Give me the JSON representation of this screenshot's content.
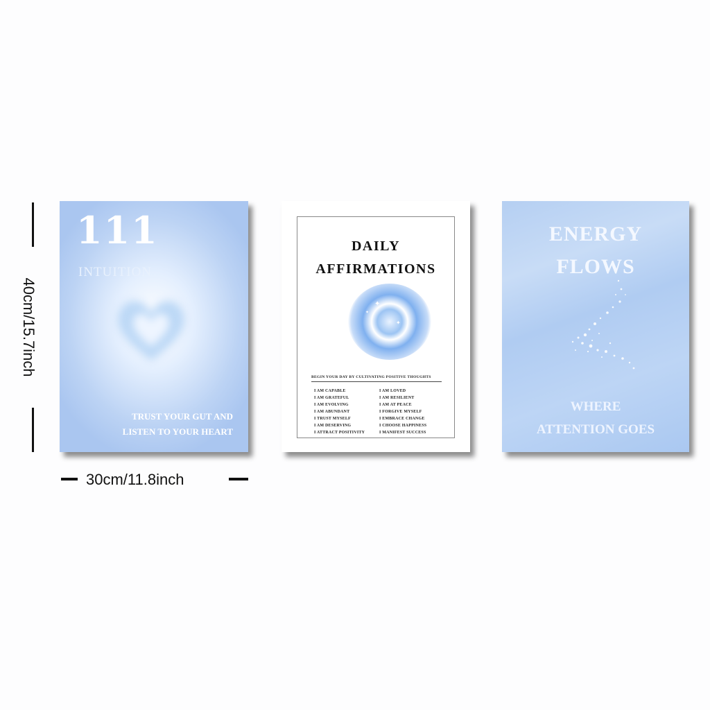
{
  "posters": [
    {
      "number": "111",
      "subtitle": "INTUITION",
      "message_line1": "TRUST YOUR GUT AND",
      "message_line2": "LISTEN TO YOUR HEART"
    },
    {
      "title_line1": "DAILY",
      "title_line2": "AFFIRMATIONS",
      "intro": "BEGIN YOUR DAY BY CULTIVATING POSITIVE THOUGHTS",
      "affirmations_left": [
        "I AM CAPABLE",
        "I AM GRATEFUL",
        "I AM EVOLVING",
        "I AM ABUNDANT",
        "I TRUST MYSELF",
        "I AM DESERVING",
        "I ATTRACT POSITIVITY"
      ],
      "affirmations_right": [
        "I AM LOVED",
        "I AM RESILIENT",
        "I AM AT PEACE",
        "I FORGIVE MYSELF",
        "I EMBRACE CHANGE",
        "I CHOOSE HAPPINESS",
        "I MANIFEST SUCCESS"
      ]
    },
    {
      "title_line1": "ENERGY",
      "title_line2": "FLOWS",
      "sub_line1": "WHERE",
      "sub_line2": "ATTENTION GOES"
    }
  ],
  "dimensions": {
    "width_label": "30cm/11.8inch",
    "height_label": "40cm/15.7inch"
  },
  "colors": {
    "poster_blue": "#b5cff2",
    "text_white": "#ffffff",
    "dark_text": "#111111"
  }
}
